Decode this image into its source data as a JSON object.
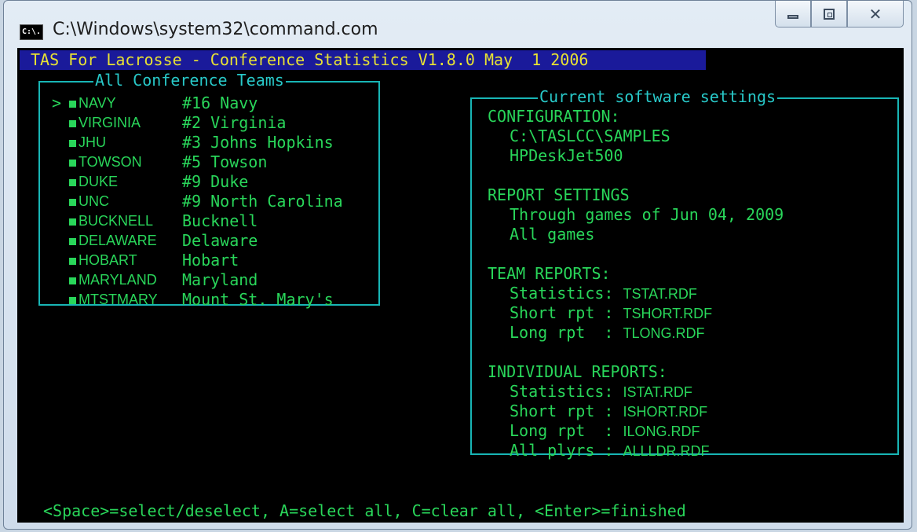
{
  "window": {
    "title": "C:\\Windows\\system32\\command.com",
    "icon_text": "C:\\."
  },
  "console": {
    "title": "TAS For Lacrosse - Conference Statistics V1.8.0 May  1 2006"
  },
  "teams": {
    "box_title": "All Conference Teams",
    "cursor": ">",
    "items": [
      {
        "code": "NAVY",
        "name": "#16 Navy"
      },
      {
        "code": "VIRGINIA",
        "name": "#2 Virginia"
      },
      {
        "code": "JHU",
        "name": "#3 Johns Hopkins"
      },
      {
        "code": "TOWSON",
        "name": "#5 Towson"
      },
      {
        "code": "DUKE",
        "name": "#9 Duke"
      },
      {
        "code": "UNC",
        "name": "#9 North Carolina"
      },
      {
        "code": "BUCKNELL",
        "name": "Bucknell"
      },
      {
        "code": "DELAWARE",
        "name": "Delaware"
      },
      {
        "code": "HOBART",
        "name": "Hobart"
      },
      {
        "code": "MARYLAND",
        "name": "Maryland"
      },
      {
        "code": "MTSTMARY",
        "name": "Mount St. Mary's"
      }
    ]
  },
  "settings": {
    "box_title": "Current software settings",
    "configuration": {
      "heading": "CONFIGURATION:",
      "path": "C:\\TASLCC\\SAMPLES",
      "printer": "HPDeskJet500"
    },
    "report_settings": {
      "heading": "REPORT SETTINGS",
      "through": "Through games of Jun 04, 2009",
      "games": "All games"
    },
    "team_reports": {
      "heading": "TEAM REPORTS:",
      "statistics_label": "Statistics: ",
      "statistics_file": "TSTAT.RDF",
      "short_label": "Short rpt : ",
      "short_file": "TSHORT.RDF",
      "long_label": "Long rpt  : ",
      "long_file": "TLONG.RDF"
    },
    "individual_reports": {
      "heading": "INDIVIDUAL REPORTS:",
      "statistics_label": "Statistics: ",
      "statistics_file": "ISTAT.RDF",
      "short_label": "Short rpt : ",
      "short_file": "ISHORT.RDF",
      "long_label": "Long rpt  : ",
      "long_file": "ILONG.RDF",
      "all_label": "All plyrs : ",
      "all_file": "ALLLDR.RDF"
    }
  },
  "hotkeys": "<Space>=select/deselect, A=select all, C=clear all, <Enter>=finished",
  "colors": {
    "console_bg": "#000000",
    "text_green": "#29d65a",
    "title_bar_bg": "#1a1a9a",
    "title_text_yellow": "#e8e233",
    "box_cyan": "#18b5b5"
  }
}
